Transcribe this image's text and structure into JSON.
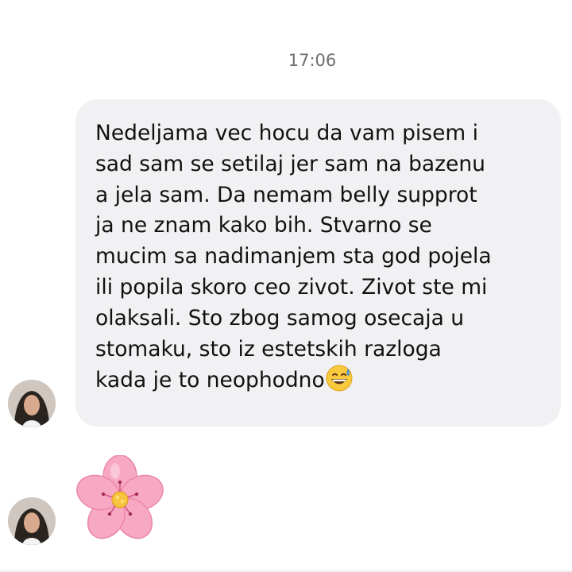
{
  "timestamp": "17:06",
  "message": {
    "lines": [
      "Nedeljama vec hocu da vam pisem i",
      "sad sam se setilaj jer sam na bazenu",
      "a jela sam. Da nemam belly supprot",
      "ja ne znam kako bih. Stvarno se",
      "mucim sa nadimanjem sta god pojela",
      "ili popila skoro ceo zivot. Zivot ste mi",
      "olaksali. Sto zbog samog osecaja u",
      "stomaku, sto iz estetskih razloga",
      "kada je to neophodno"
    ],
    "trailing_emoji": "grinning-face-with-sweat-icon"
  },
  "second_message": {
    "emoji": "cherry-blossom-icon"
  },
  "colors": {
    "bubble": "#f1f1f4",
    "text": "#111111",
    "timestamp": "#6e6e73"
  }
}
